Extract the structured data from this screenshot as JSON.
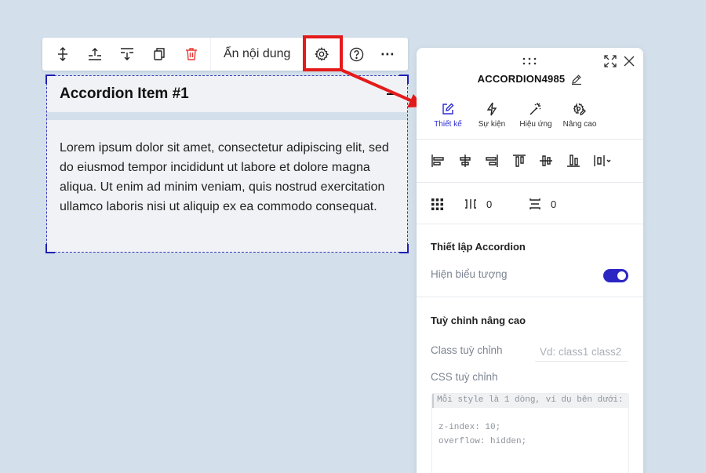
{
  "toolbar": {
    "icons": [
      "move-icon",
      "insert-above-icon",
      "insert-below-icon",
      "duplicate-icon",
      "delete-icon",
      "gear-icon",
      "help-icon",
      "more-icon"
    ],
    "hide_content_label": "Ẩn nội dung",
    "more_label": "⋯",
    "delete_color": "#e53935"
  },
  "accordion": {
    "title": "Accordion Item #1",
    "body": "Lorem ipsum dolor sit amet, consectetur adipiscing elit, sed do eiusmod tempor incididunt ut labore et dolore magna aliqua. Ut enim ad minim veniam, quis nostrud exercitation ullamco laboris nisi ut aliquip ex ea commodo consequat.",
    "selection_color": "#1f1fb5"
  },
  "annotation": {
    "color": "#e41b1b"
  },
  "panel": {
    "title": "ACCORDION4985",
    "tabs": [
      {
        "label": "Thiết kế",
        "icon": "pencil-square-icon",
        "active": true
      },
      {
        "label": "Sự kiện",
        "icon": "lightning-icon",
        "active": false
      },
      {
        "label": "Hiệu ứng",
        "icon": "magic-wand-icon",
        "active": false
      },
      {
        "label": "Nâng cao",
        "icon": "settings-pen-icon",
        "active": false
      }
    ],
    "alignment_icons": [
      "align-left-icon",
      "align-center-horizontal-icon",
      "align-right-icon",
      "align-top-icon",
      "align-middle-vertical-icon",
      "align-bottom-icon",
      "distribute-dropdown-icon"
    ],
    "gap": {
      "column_gap": "0",
      "row_gap": "0"
    },
    "accordion_settings": {
      "title": "Thiết lập Accordion",
      "show_icon_label": "Hiện biểu tượng",
      "show_icon": true
    },
    "advanced": {
      "title": "Tuỳ chỉnh nâng cao",
      "class_label": "Class tuỳ chỉnh",
      "class_placeholder": "Vd: class1 class2",
      "css_label": "CSS tuỳ chỉnh",
      "css_hint": "Mỗi style là 1 dòng, ví dụ bên dưới:",
      "css_examples": [
        "z-index: 10;",
        "overflow: hidden;"
      ]
    },
    "accent_color": "#2b25c4"
  }
}
